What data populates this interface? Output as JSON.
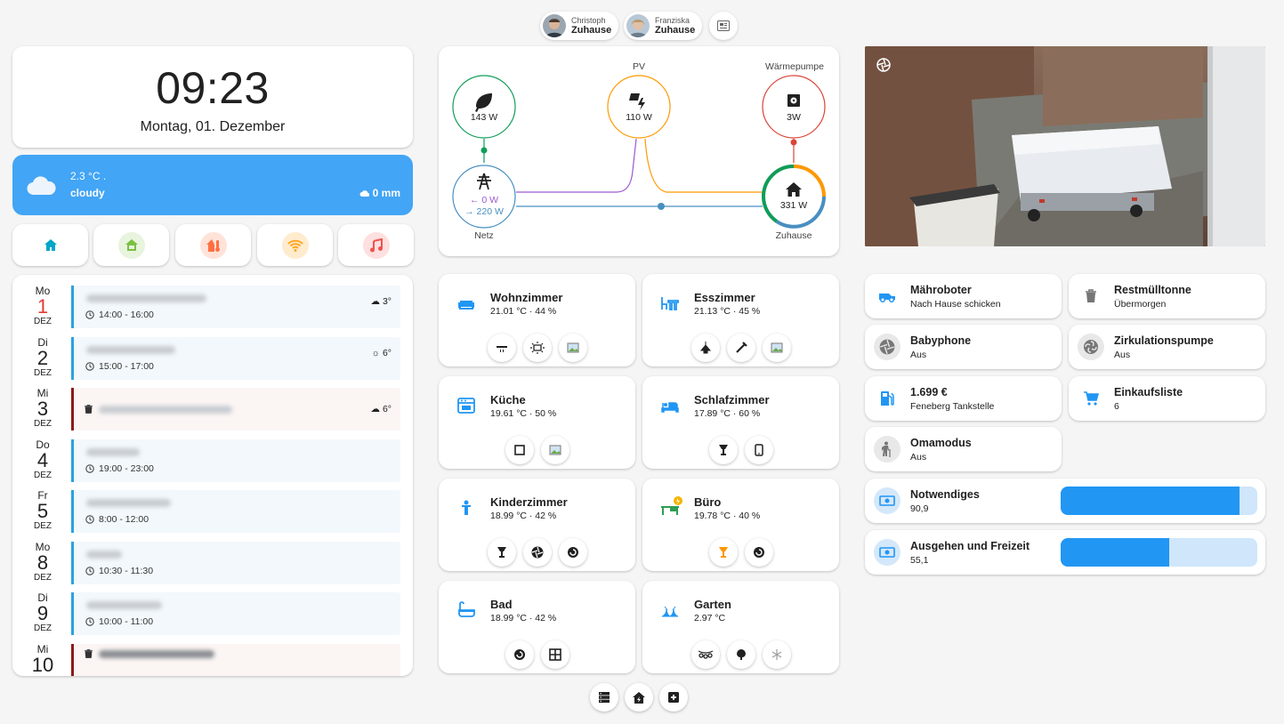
{
  "persons": [
    {
      "name": "Christoph",
      "state": "Zuhause"
    },
    {
      "name": "Franziska",
      "state": "Zuhause"
    }
  ],
  "clock": {
    "time": "09:23",
    "date": "Montag, 01. Dezember"
  },
  "weather": {
    "temp": "2.3 °C .",
    "condition": "cloudy",
    "precip": "0 mm",
    "icon": "cloud-icon"
  },
  "nav": [
    {
      "icon": "home-icon",
      "color": "#00a6c9",
      "bg": "transparent"
    },
    {
      "icon": "home-outline-icon",
      "color": "#7ac142",
      "bg": "#e8f4de"
    },
    {
      "icon": "home-thermometer-icon",
      "color": "#ff7043",
      "bg": "#ffe3d8"
    },
    {
      "icon": "wifi-icon",
      "color": "#ffa726",
      "bg": "#ffeccf"
    },
    {
      "icon": "music-icon",
      "color": "#ef5350",
      "bg": "#fde0df"
    }
  ],
  "calendar": [
    {
      "wd": "Mo",
      "num": "1",
      "mon": "DEZ",
      "today": true,
      "time": "14:00 - 16:00",
      "weather": "3°",
      "wx_icon": "cloud-icon"
    },
    {
      "wd": "Di",
      "num": "2",
      "mon": "DEZ",
      "today": false,
      "time": "15:00 - 17:00",
      "weather": "6°",
      "wx_icon": "sun-icon"
    },
    {
      "wd": "Mi",
      "num": "3",
      "mon": "DEZ",
      "today": false,
      "time": "",
      "weather": "6°",
      "wx_icon": "cloud-icon"
    },
    {
      "wd": "Do",
      "num": "4",
      "mon": "DEZ",
      "today": false,
      "time": "19:00 - 23:00",
      "weather": "",
      "wx_icon": ""
    },
    {
      "wd": "Fr",
      "num": "5",
      "mon": "DEZ",
      "today": false,
      "time": "8:00 - 12:00",
      "weather": "",
      "wx_icon": ""
    },
    {
      "wd": "Mo",
      "num": "8",
      "mon": "DEZ",
      "today": false,
      "time": "10:30 - 11:30",
      "weather": "",
      "wx_icon": ""
    },
    {
      "wd": "Di",
      "num": "9",
      "mon": "DEZ",
      "today": false,
      "time": "10:00 - 11:00",
      "weather": "",
      "wx_icon": ""
    },
    {
      "wd": "Mi",
      "num": "10",
      "mon": "",
      "today": false,
      "time": "",
      "weather": "",
      "wx_icon": ""
    }
  ],
  "energy": {
    "low_carbon": {
      "value": "143 W",
      "icon": "leaf-icon",
      "color": "#0f9d58"
    },
    "solar": {
      "label": "PV",
      "value": "110 W",
      "icon": "solar-power-icon",
      "color": "#ff9800"
    },
    "heatpump": {
      "label": "Wärmepumpe",
      "value": "3W",
      "icon": "heat-pump-icon",
      "color": "#db4437"
    },
    "grid": {
      "label": "Netz",
      "value_in": "0 W",
      "value_out": "220 W",
      "icon": "transmission-tower-icon",
      "color": "#488fc2"
    },
    "home": {
      "label": "Zuhause",
      "value": "331 W",
      "icon": "home-icon"
    }
  },
  "rooms": [
    {
      "name": "Wohnzimmer",
      "state": "21.01 °C · 44 %",
      "icon": "sofa-icon",
      "buttons": [
        "ceiling-light-icon",
        "light-strip-icon",
        "image-icon"
      ]
    },
    {
      "name": "Esszimmer",
      "state": "21.13 °C · 45 %",
      "icon": "table-chair-icon",
      "buttons": [
        "chandelier-icon",
        "wand-icon",
        "image-icon"
      ]
    },
    {
      "name": "Küche",
      "state": "19.61 °C · 50 %",
      "icon": "stove-icon",
      "buttons": [
        "square-outline-icon",
        "image-icon"
      ]
    },
    {
      "name": "Schlafzimmer",
      "state": "17.89 °C · 60 %",
      "icon": "bed-icon",
      "buttons": [
        "floor-lamp-icon",
        "cellphone-icon"
      ]
    },
    {
      "name": "Kinderzimmer",
      "state": "18.99 °C · 42 %",
      "icon": "human-child-icon",
      "buttons": [
        "floor-lamp-icon",
        "camera-iris-icon",
        "air-purifier-icon"
      ]
    },
    {
      "name": "Büro",
      "state": "19.78 °C · 40 %",
      "icon": "desk-icon",
      "buttons": [
        "floor-lamp-active-icon",
        "air-purifier-icon"
      ]
    },
    {
      "name": "Bad",
      "state": "18.99 °C · 42 %",
      "icon": "bathtub-icon",
      "buttons": [
        "air-purifier-icon",
        "window-icon"
      ]
    },
    {
      "name": "Garten",
      "state": "2.97 °C",
      "icon": "grass-icon",
      "buttons": [
        "string-lights-icon",
        "tree-icon",
        "snowflake-icon"
      ]
    }
  ],
  "tiles": [
    {
      "name": "Mähroboter",
      "state": "Nach Hause schicken",
      "icon": "robot-mower-icon",
      "color": "#2196f3",
      "bg": "#fff"
    },
    {
      "name": "Restmülltonne",
      "state": "Übermorgen",
      "icon": "trash-can-icon",
      "color": "#757575",
      "bg": "#fff"
    },
    {
      "name": "Babyphone",
      "state": "Aus",
      "icon": "camera-iris-icon",
      "color": "#777",
      "bg": "#e8e8e8"
    },
    {
      "name": "Zirkulationspumpe",
      "state": "Aus",
      "icon": "pump-icon",
      "color": "#777",
      "bg": "#e8e8e8"
    },
    {
      "name": "1.699 €",
      "state": "Feneberg Tankstelle",
      "icon": "gas-station-icon",
      "color": "#2196f3",
      "bg": "#fff"
    },
    {
      "name": "Einkaufsliste",
      "state": "6",
      "icon": "cart-icon",
      "color": "#2196f3",
      "bg": "#fff"
    },
    {
      "name": "Omamodus",
      "state": "Aus",
      "icon": "human-cane-icon",
      "color": "#777",
      "bg": "#e8e8e8"
    }
  ],
  "budgets": [
    {
      "name": "Notwendiges",
      "value": "90,9",
      "fill": 0.909,
      "icon": "cash-icon"
    },
    {
      "name": "Ausgehen und Freizeit",
      "value": "55,1",
      "fill": 0.551,
      "icon": "cash-icon"
    }
  ],
  "bottom_nav": [
    "server-icon",
    "home-lightning-icon",
    "hospital-box-icon"
  ]
}
